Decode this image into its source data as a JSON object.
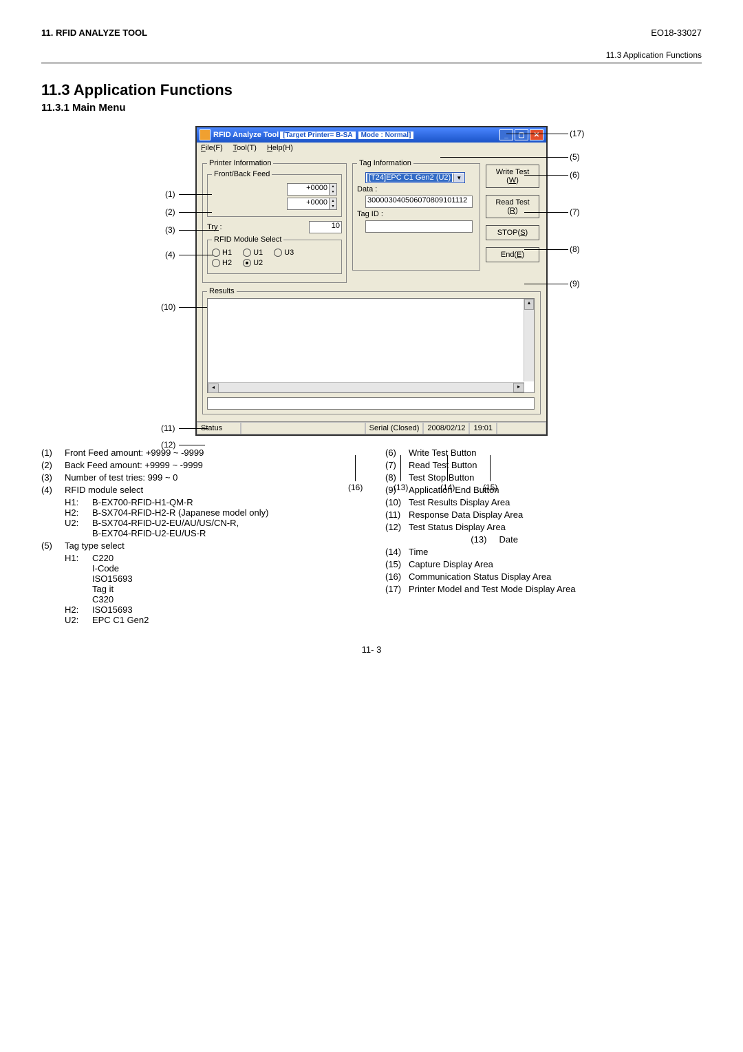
{
  "header": {
    "chapter": "11. RFID ANALYZE TOOL",
    "doc": "EO18-33027",
    "breadcrumb": "11.3 Application Functions"
  },
  "sec": {
    "h2": "11.3  Application Functions",
    "h3": "11.3.1 Main Menu"
  },
  "win": {
    "title_app": "RFID Analyze Tool",
    "title_target": "[Target Printer= B-SA",
    "title_mode": "Mode : Normal]",
    "menu": {
      "file": "File(F)",
      "tool": "Tool(T)",
      "help": "Help(H)"
    },
    "pi": "Printer Information",
    "ff": "Front/Back Feed",
    "feed1": "+0000",
    "feed2": "+0000",
    "try_lbl": "Try :",
    "try_val": "10",
    "rms": "RFID Module Select",
    "h1": "H1",
    "u1": "U1",
    "u3": "U3",
    "h2": "H2",
    "u2": "U2",
    "ti": "Tag Information",
    "sel": "[T24]EPC C1 Gen2 (U2)",
    "data_lbl": "Data :",
    "data_val": "300003040506070809101112",
    "tagid_lbl": "Tag ID :",
    "write": "Write Test",
    "write_u": "(W)",
    "read": "Read Test",
    "read_u": "(R)",
    "stop": "STOP(S)",
    "end": "End(E)",
    "results": "Results",
    "status": "Status",
    "serial": "Serial (Closed)",
    "date": "2008/02/12",
    "time": "19:01"
  },
  "call": {
    "c1": "(1)",
    "c2": "(2)",
    "c3": "(3)",
    "c4": "(4)",
    "c5": "(5)",
    "c6": "(6)",
    "c7": "(7)",
    "c8": "(8)",
    "c9": "(9)",
    "c10": "(10)",
    "c11": "(11)",
    "c12": "(12)",
    "c13": "(13)",
    "c14": "(14)",
    "c15": "(15)",
    "c16": "(16)",
    "c17": "(17)"
  },
  "L": {
    "l1n": "(1)",
    "l1t": "Front Feed amount:      +9999 ~ -9999",
    "l2n": "(2)",
    "l2t": "Back Feed amount:      +9999 ~ -9999",
    "l3n": "(3)",
    "l3t": "Number of test tries:     999 ~ 0",
    "l4n": "(4)",
    "l4t": "RFID module select",
    "l4h1k": "H1:",
    "l4h1v": "B-EX700-RFID-H1-QM-R",
    "l4h2k": "H2:",
    "l4h2v": "B-SX704-RFID-H2-R (Japanese model only)",
    "l4u2k": "U2:",
    "l4u2v": "B-SX704-RFID-U2-EU/AU/US/CN-R,",
    "l4u2v2": "B-EX704-RFID-U2-EU/US-R",
    "l5n": "(5)",
    "l5t": "Tag type select",
    "l5h1k": "H1:",
    "l5h1a": "C220",
    "l5h1b": "I-Code",
    "l5h1c": "ISO15693",
    "l5h1d": "Tag it",
    "l5h1e": "C320",
    "l5h2k": "H2:",
    "l5h2v": "ISO15693",
    "l5u2k": "U2:",
    "l5u2v": "EPC C1 Gen2"
  },
  "R": {
    "r6n": "(6)",
    "r6t": "Write Test Button",
    "r7n": "(7)",
    "r7t": "Read Test Button",
    "r8n": "(8)",
    "r8t": "Test Stop Button",
    "r9n": "(9)",
    "r9t": "Application End Button",
    "r10n": "(10)",
    "r10t": "Test Results Display Area",
    "r11n": "(11)",
    "r11t": "Response Data Display Area",
    "r12n": "(12)",
    "r12t": "Test Status Display Area",
    "r13n": "(13)",
    "r13t": "Date",
    "r13pad": "                         ",
    "r14n": "(14)",
    "r14t": "Time",
    "r15n": "(15)",
    "r15t": "Capture Display Area",
    "r16n": "(16)",
    "r16t": "Communication Status Display Area",
    "r17n": "(17)",
    "r17t": "Printer Model and Test Mode Display Area"
  },
  "page": "11- 3"
}
